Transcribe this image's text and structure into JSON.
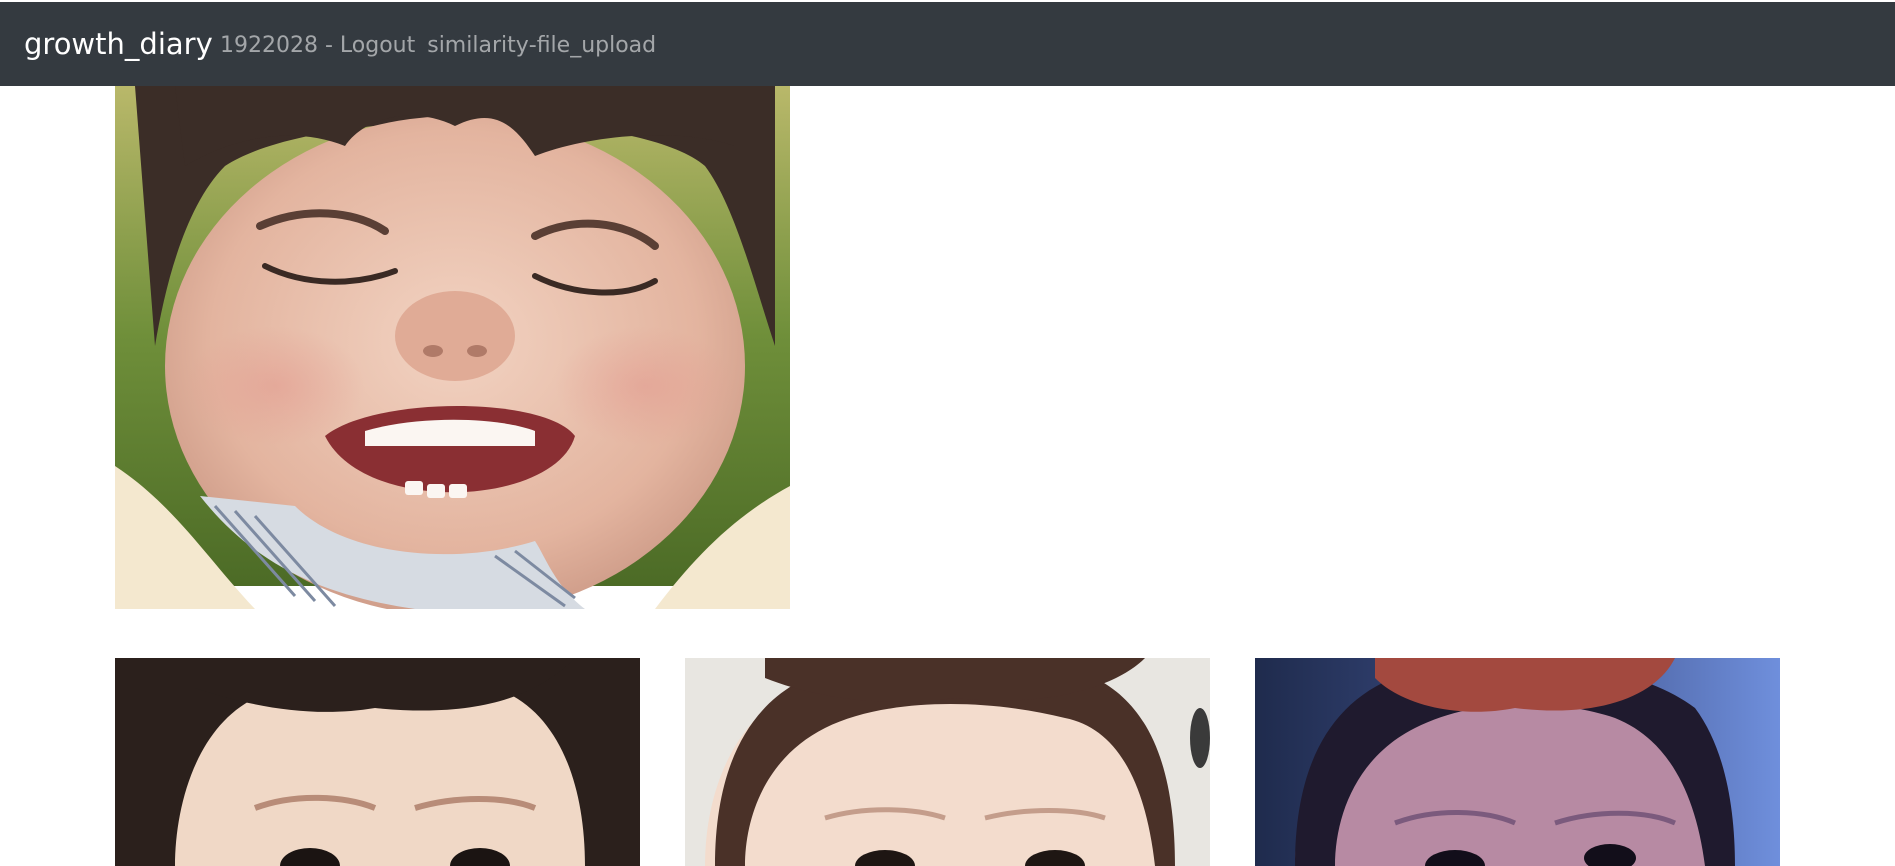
{
  "navbar": {
    "brand": "growth_diary",
    "user_id_text": "1922028 - ",
    "logout_label": "Logout",
    "similarity_label": "similarity",
    "file_upload_label": "-file_upload",
    "background_color": "#343a40"
  },
  "gallery": {
    "main_photo": {
      "subject": "smiling toddler"
    },
    "thumbnails": [
      {
        "subject": "toddler face close-up"
      },
      {
        "subject": "toddler face close-up"
      },
      {
        "subject": "toddler face close-up, blue tinted"
      }
    ]
  }
}
